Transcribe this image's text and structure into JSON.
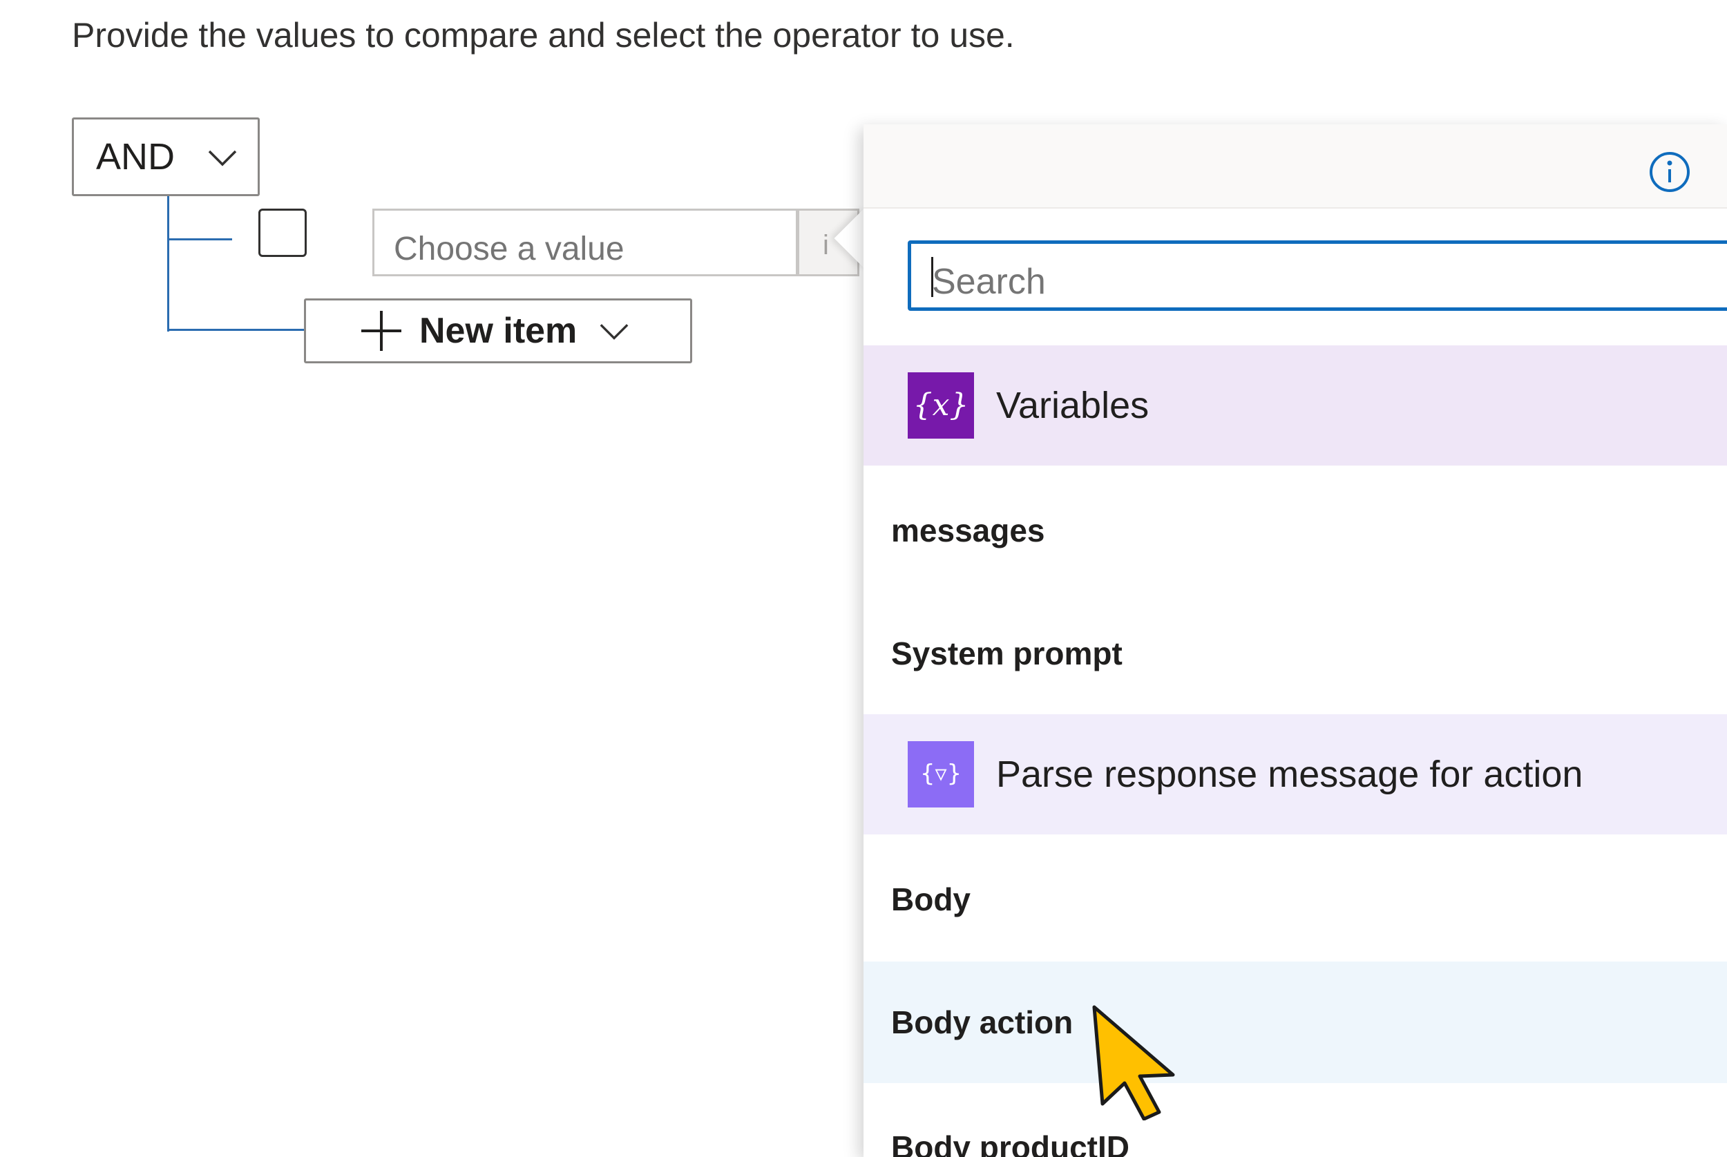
{
  "instruction": "Provide the values to compare and select the operator to use.",
  "condition_group": {
    "operator": "AND",
    "row": {
      "value_placeholder": "Choose a value",
      "operator_stub": "i"
    },
    "new_item_label": "New item"
  },
  "dynamic_content": {
    "search": {
      "placeholder": "Search"
    },
    "sections": [
      {
        "title": "Variables",
        "icon": "variables-icon",
        "icon_color": "#7719aa",
        "items": [
          "messages",
          "System prompt"
        ]
      },
      {
        "title": "Parse response message for action",
        "icon": "parse-json-icon",
        "icon_color": "#8c6cf5",
        "items": [
          "Body",
          "Body action",
          "Body productID"
        ]
      }
    ],
    "hovered_item": "Body action"
  },
  "colors": {
    "accent": "#0f6cbd",
    "tree_line": "#2b6cb0",
    "hover_bg": "#eef6fc"
  }
}
